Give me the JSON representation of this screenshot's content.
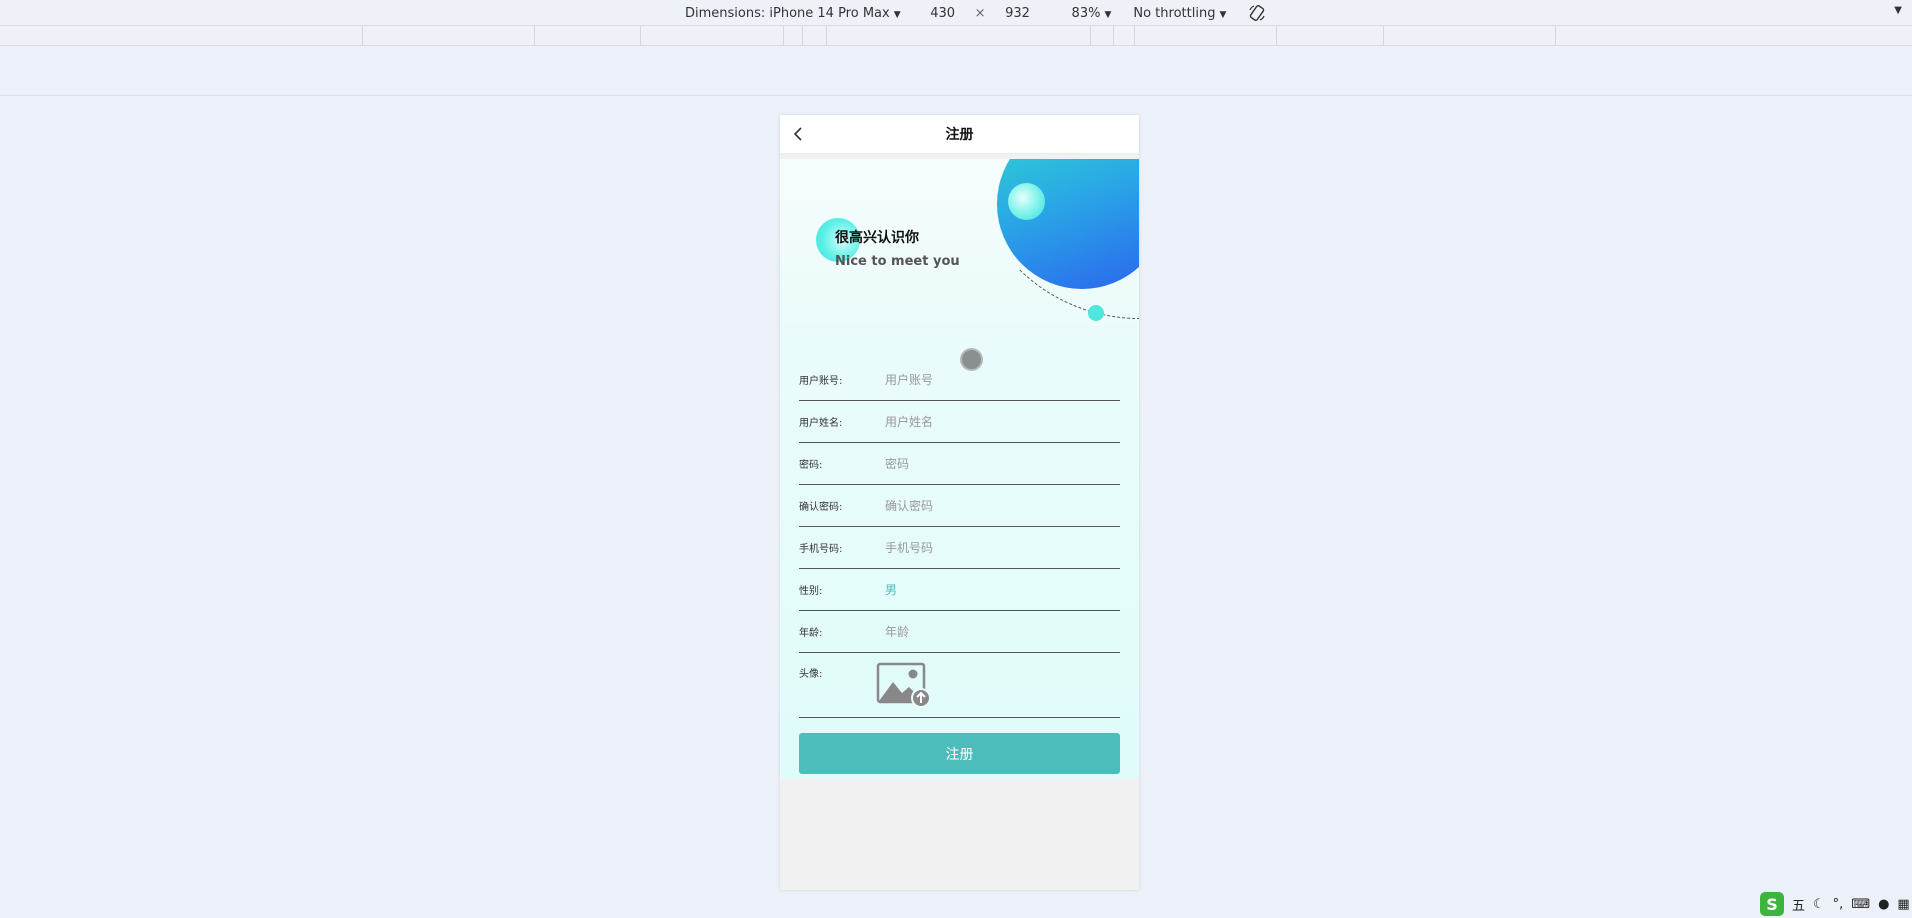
{
  "devtools": {
    "dimensions_label": "Dimensions: iPhone 14 Pro Max",
    "width": "430",
    "times": "×",
    "height": "932",
    "zoom": "83%",
    "throttling": "No throttling"
  },
  "navbar": {
    "title": "注册"
  },
  "hero": {
    "title": "很高兴认识你",
    "subtitle": "Nice to meet you"
  },
  "form": {
    "account": {
      "label": "用户账号:",
      "placeholder": "用户账号"
    },
    "name": {
      "label": "用户姓名:",
      "placeholder": "用户姓名"
    },
    "password": {
      "label": "密码:",
      "placeholder": "密码"
    },
    "confirm": {
      "label": "确认密码:",
      "placeholder": "确认密码"
    },
    "phone": {
      "label": "手机号码:",
      "placeholder": "手机号码"
    },
    "gender": {
      "label": "性别:",
      "value": "男"
    },
    "age": {
      "label": "年龄:",
      "placeholder": "年龄"
    },
    "avatar": {
      "label": "头像:"
    }
  },
  "submit_label": "注册",
  "ime": {
    "mode": "五"
  },
  "colors": {
    "accent": "#4cbdba",
    "background": "#ecf0f8"
  }
}
